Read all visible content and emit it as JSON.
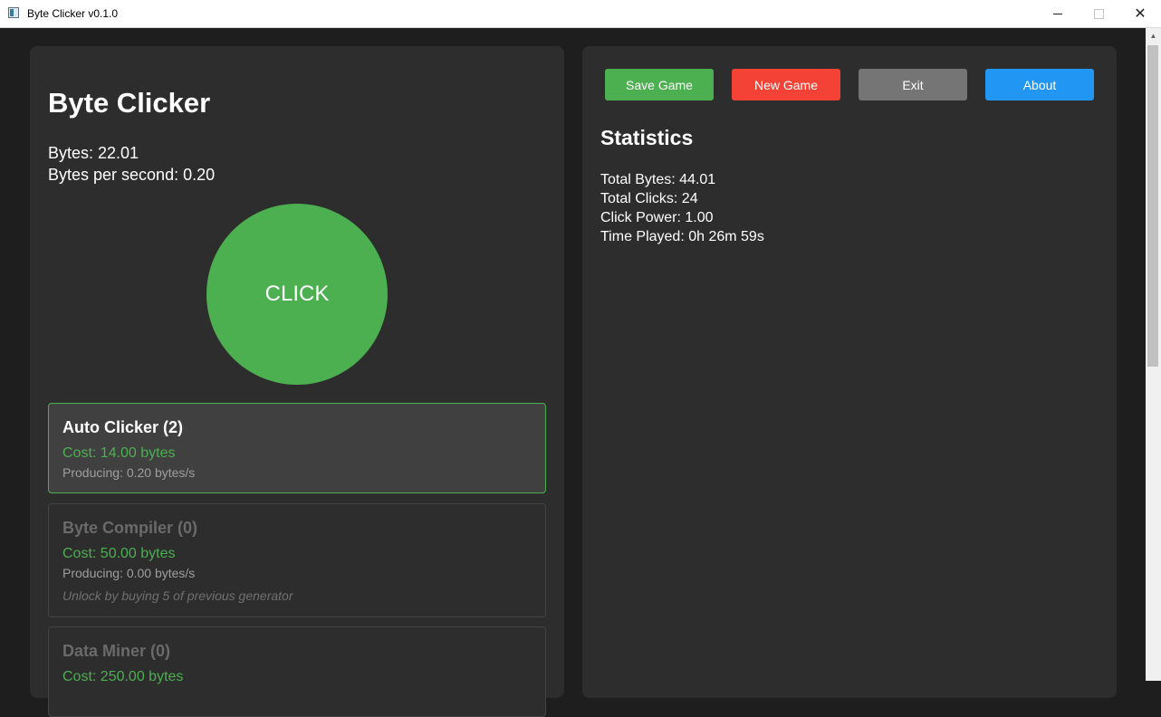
{
  "window": {
    "title": "Byte Clicker v0.1.0",
    "controls": {
      "close_glyph": "✕"
    }
  },
  "game": {
    "title": "Byte Clicker",
    "bytes": "Bytes: 22.01",
    "bytes_per_second": "Bytes per second: 0.20",
    "click_label": "CLICK"
  },
  "generators": [
    {
      "name": "Auto Clicker (2)",
      "cost": "Cost: 14.00 bytes",
      "producing": "Producing: 0.20 bytes/s",
      "state": "active"
    },
    {
      "name": "Byte Compiler (0)",
      "cost": "Cost: 50.00 bytes",
      "producing": "Producing: 0.00 bytes/s",
      "unlock_hint": "Unlock by buying 5 of previous generator",
      "state": "locked"
    },
    {
      "name": "Data Miner (0)",
      "cost": "Cost: 250.00 bytes",
      "state": "locked"
    }
  ],
  "actions": {
    "save": "Save Game",
    "new": "New Game",
    "exit": "Exit",
    "about": "About"
  },
  "statistics": {
    "title": "Statistics",
    "total_bytes": "Total Bytes: 44.01",
    "total_clicks": "Total Clicks: 24",
    "click_power": "Click Power: 1.00",
    "time_played": "Time Played: 0h 26m 59s"
  },
  "colors": {
    "accent_green": "#4caf50",
    "danger_red": "#f44336",
    "neutral_gray": "#757575",
    "info_blue": "#2196f3",
    "panel_bg": "#2d2d2d",
    "window_bg": "#1e1e1e"
  }
}
